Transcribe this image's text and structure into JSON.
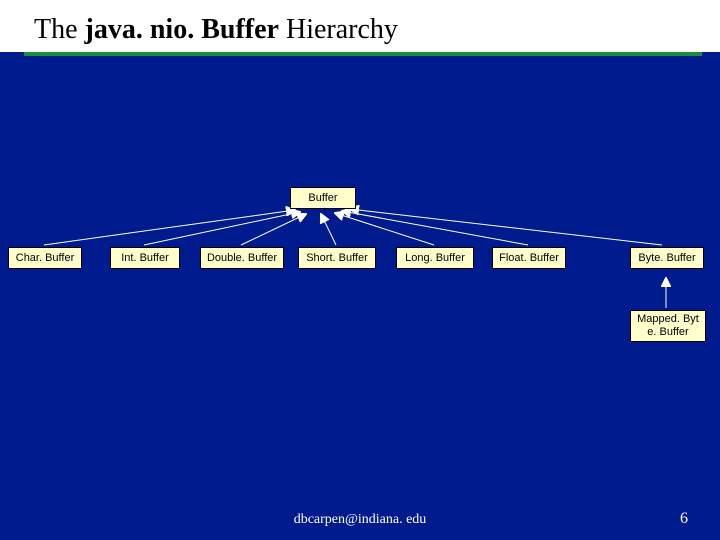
{
  "title": {
    "prefix": "The ",
    "classpath": "java. nio. Buffer",
    "suffix": " Hierarchy"
  },
  "nodes": {
    "root": "Buffer",
    "char": "Char. Buffer",
    "int": "Int. Buffer",
    "double": "Double. Buffer",
    "short": "Short. Buffer",
    "long": "Long. Buffer",
    "float": "Float. Buffer",
    "byte": "Byte. Buffer",
    "mapped_l1": "Mapped. Byt",
    "mapped_l2": "e. Buffer"
  },
  "footer": {
    "email": "dbcarpen@indiana. edu",
    "page": "6"
  }
}
